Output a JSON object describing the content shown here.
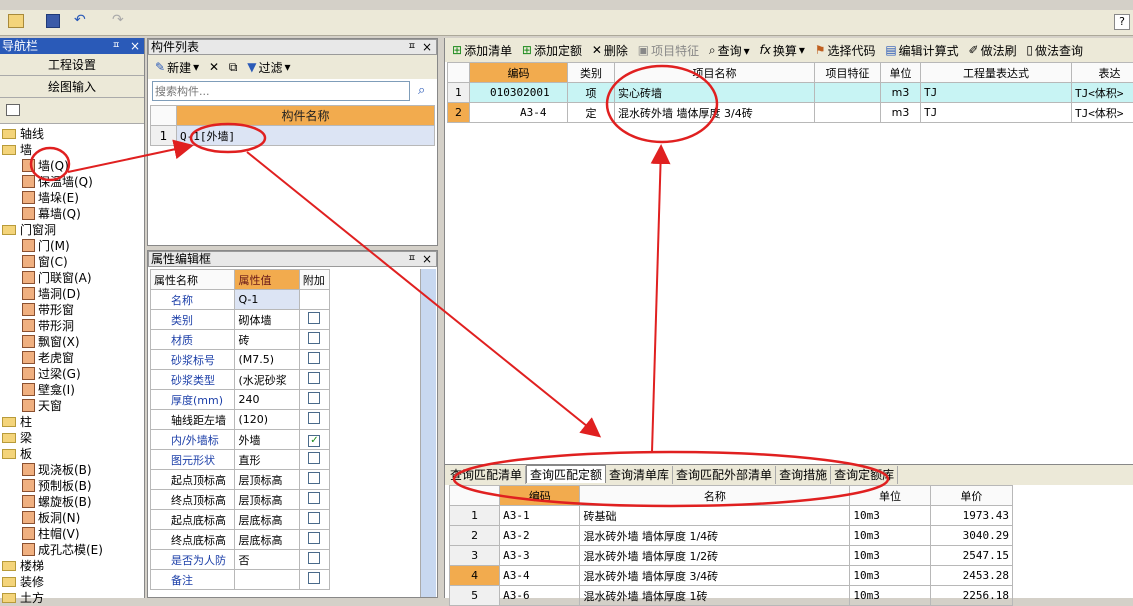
{
  "toolbar_top": {
    "icons": [
      "folder-open-icon",
      "save-icon",
      "undo-icon",
      "redo-icon",
      "help-icon"
    ]
  },
  "nav": {
    "title": "导航栏",
    "pin": "ㅍ",
    "close": "×",
    "btn1": "工程设置",
    "btn2": "绘图输入",
    "tree": [
      {
        "label": "轴线",
        "level": 0,
        "type": "folder"
      },
      {
        "label": "墙",
        "level": 0,
        "type": "folder-open"
      },
      {
        "label": "墙(Q)",
        "level": 1,
        "type": "item"
      },
      {
        "label": "保温墙(Q)",
        "level": 1,
        "type": "item"
      },
      {
        "label": "墙垛(E)",
        "level": 1,
        "type": "item"
      },
      {
        "label": "幕墙(Q)",
        "level": 1,
        "type": "item"
      },
      {
        "label": "门窗洞",
        "level": 0,
        "type": "folder-open"
      },
      {
        "label": "门(M)",
        "level": 1,
        "type": "item"
      },
      {
        "label": "窗(C)",
        "level": 1,
        "type": "item"
      },
      {
        "label": "门联窗(A)",
        "level": 1,
        "type": "item"
      },
      {
        "label": "墙洞(D)",
        "level": 1,
        "type": "item"
      },
      {
        "label": "带形窗",
        "level": 1,
        "type": "item"
      },
      {
        "label": "带形洞",
        "level": 1,
        "type": "item"
      },
      {
        "label": "飘窗(X)",
        "level": 1,
        "type": "item"
      },
      {
        "label": "老虎窗",
        "level": 1,
        "type": "item"
      },
      {
        "label": "过梁(G)",
        "level": 1,
        "type": "item"
      },
      {
        "label": "壁龛(I)",
        "level": 1,
        "type": "item"
      },
      {
        "label": "天窗",
        "level": 1,
        "type": "item"
      },
      {
        "label": "柱",
        "level": 0,
        "type": "folder"
      },
      {
        "label": "梁",
        "level": 0,
        "type": "folder"
      },
      {
        "label": "板",
        "level": 0,
        "type": "folder-open"
      },
      {
        "label": "现浇板(B)",
        "level": 1,
        "type": "item"
      },
      {
        "label": "预制板(B)",
        "level": 1,
        "type": "item"
      },
      {
        "label": "螺旋板(B)",
        "level": 1,
        "type": "item"
      },
      {
        "label": "板洞(N)",
        "level": 1,
        "type": "item"
      },
      {
        "label": "柱帽(V)",
        "level": 1,
        "type": "item"
      },
      {
        "label": "成孔芯模(E)",
        "level": 1,
        "type": "item"
      },
      {
        "label": "楼梯",
        "level": 0,
        "type": "folder"
      },
      {
        "label": "装修",
        "level": 0,
        "type": "folder"
      },
      {
        "label": "土方",
        "level": 0,
        "type": "folder"
      }
    ]
  },
  "components": {
    "title": "构件列表",
    "new_label": "新建",
    "filter_label": "过滤",
    "search_placeholder": "搜索构件...",
    "col_name": "构件名称",
    "rows": [
      {
        "num": "1",
        "name": "Q-1[外墙]"
      }
    ]
  },
  "props": {
    "title": "属性编辑框",
    "col_name": "属性名称",
    "col_value": "属性值",
    "col_extra": "附加",
    "rows": [
      {
        "name": "名称",
        "value": "Q-1",
        "check": "none",
        "blue": true
      },
      {
        "name": "类别",
        "value": "砌体墙",
        "check": "off",
        "blue": true
      },
      {
        "name": "材质",
        "value": "砖",
        "check": "off",
        "blue": true
      },
      {
        "name": "砂浆标号",
        "value": "(M7.5)",
        "check": "off",
        "blue": true
      },
      {
        "name": "砂浆类型",
        "value": "(水泥砂浆",
        "check": "off",
        "blue": true
      },
      {
        "name": "厚度(mm)",
        "value": "240",
        "check": "off",
        "blue": true
      },
      {
        "name": "轴线距左墙",
        "value": "(120)",
        "check": "off",
        "blue": false
      },
      {
        "name": "内/外墙标",
        "value": "外墙",
        "check": "on",
        "blue": true
      },
      {
        "name": "图元形状",
        "value": "直形",
        "check": "off",
        "blue": true
      },
      {
        "name": "起点顶标高",
        "value": "层顶标高",
        "check": "off",
        "blue": false
      },
      {
        "name": "终点顶标高",
        "value": "层顶标高",
        "check": "off",
        "blue": false
      },
      {
        "name": "起点底标高",
        "value": "层底标高",
        "check": "off",
        "blue": false
      },
      {
        "name": "终点底标高",
        "value": "层底标高",
        "check": "off",
        "blue": false
      },
      {
        "name": "是否为人防",
        "value": "否",
        "check": "off",
        "blue": true
      },
      {
        "name": "备注",
        "value": "",
        "check": "off",
        "blue": true
      }
    ]
  },
  "main_toolbar": {
    "add_list": "添加清单",
    "add_quota": "添加定额",
    "delete": "删除",
    "item_feature": "项目特征",
    "query": "查询",
    "convert": "换算",
    "select_code": "选择代码",
    "edit_formula": "编辑计算式",
    "brush": "做法刷",
    "do_query": "做法查询"
  },
  "grid": {
    "headers": [
      "编码",
      "类别",
      "项目名称",
      "项目特征",
      "单位",
      "工程量表达式",
      "表达"
    ],
    "rows": [
      {
        "num": "1",
        "code": "010302001",
        "type": "项",
        "name": "实心砖墙",
        "feature": "",
        "unit": "m3",
        "expr": "TJ",
        "expr2": "TJ<体积>"
      },
      {
        "num": "2",
        "code": "A3-4",
        "type": "定",
        "name": "混水砖外墙 墙体厚度 3/4砖",
        "feature": "",
        "unit": "m3",
        "expr": "TJ",
        "expr2": "TJ<体积>"
      }
    ]
  },
  "bottom": {
    "tabs": [
      "查询匹配清单",
      "查询匹配定额",
      "查询清单库",
      "查询匹配外部清单",
      "查询措施",
      "查询定额库"
    ],
    "selected_tab": 1,
    "headers": [
      "编码",
      "名称",
      "单位",
      "单价"
    ],
    "rows": [
      {
        "num": "1",
        "code": "A3-1",
        "name": "砖基础",
        "unit": "10m3",
        "price": "1973.43"
      },
      {
        "num": "2",
        "code": "A3-2",
        "name": "混水砖外墙 墙体厚度 1/4砖",
        "unit": "10m3",
        "price": "3040.29"
      },
      {
        "num": "3",
        "code": "A3-3",
        "name": "混水砖外墙 墙体厚度 1/2砖",
        "unit": "10m3",
        "price": "2547.15"
      },
      {
        "num": "4",
        "code": "A3-4",
        "name": "混水砖外墙 墙体厚度 3/4砖",
        "unit": "10m3",
        "price": "2453.28"
      },
      {
        "num": "5",
        "code": "A3-6",
        "name": "混水砖外墙 墙体厚度 1砖",
        "unit": "10m3",
        "price": "2256.18"
      }
    ]
  },
  "colors": {
    "accent_orange": "#f2ab4e",
    "row_cyan": "#c8f4f4",
    "annotation_red": "#e02020",
    "title_blue": "#2a5ab8"
  }
}
